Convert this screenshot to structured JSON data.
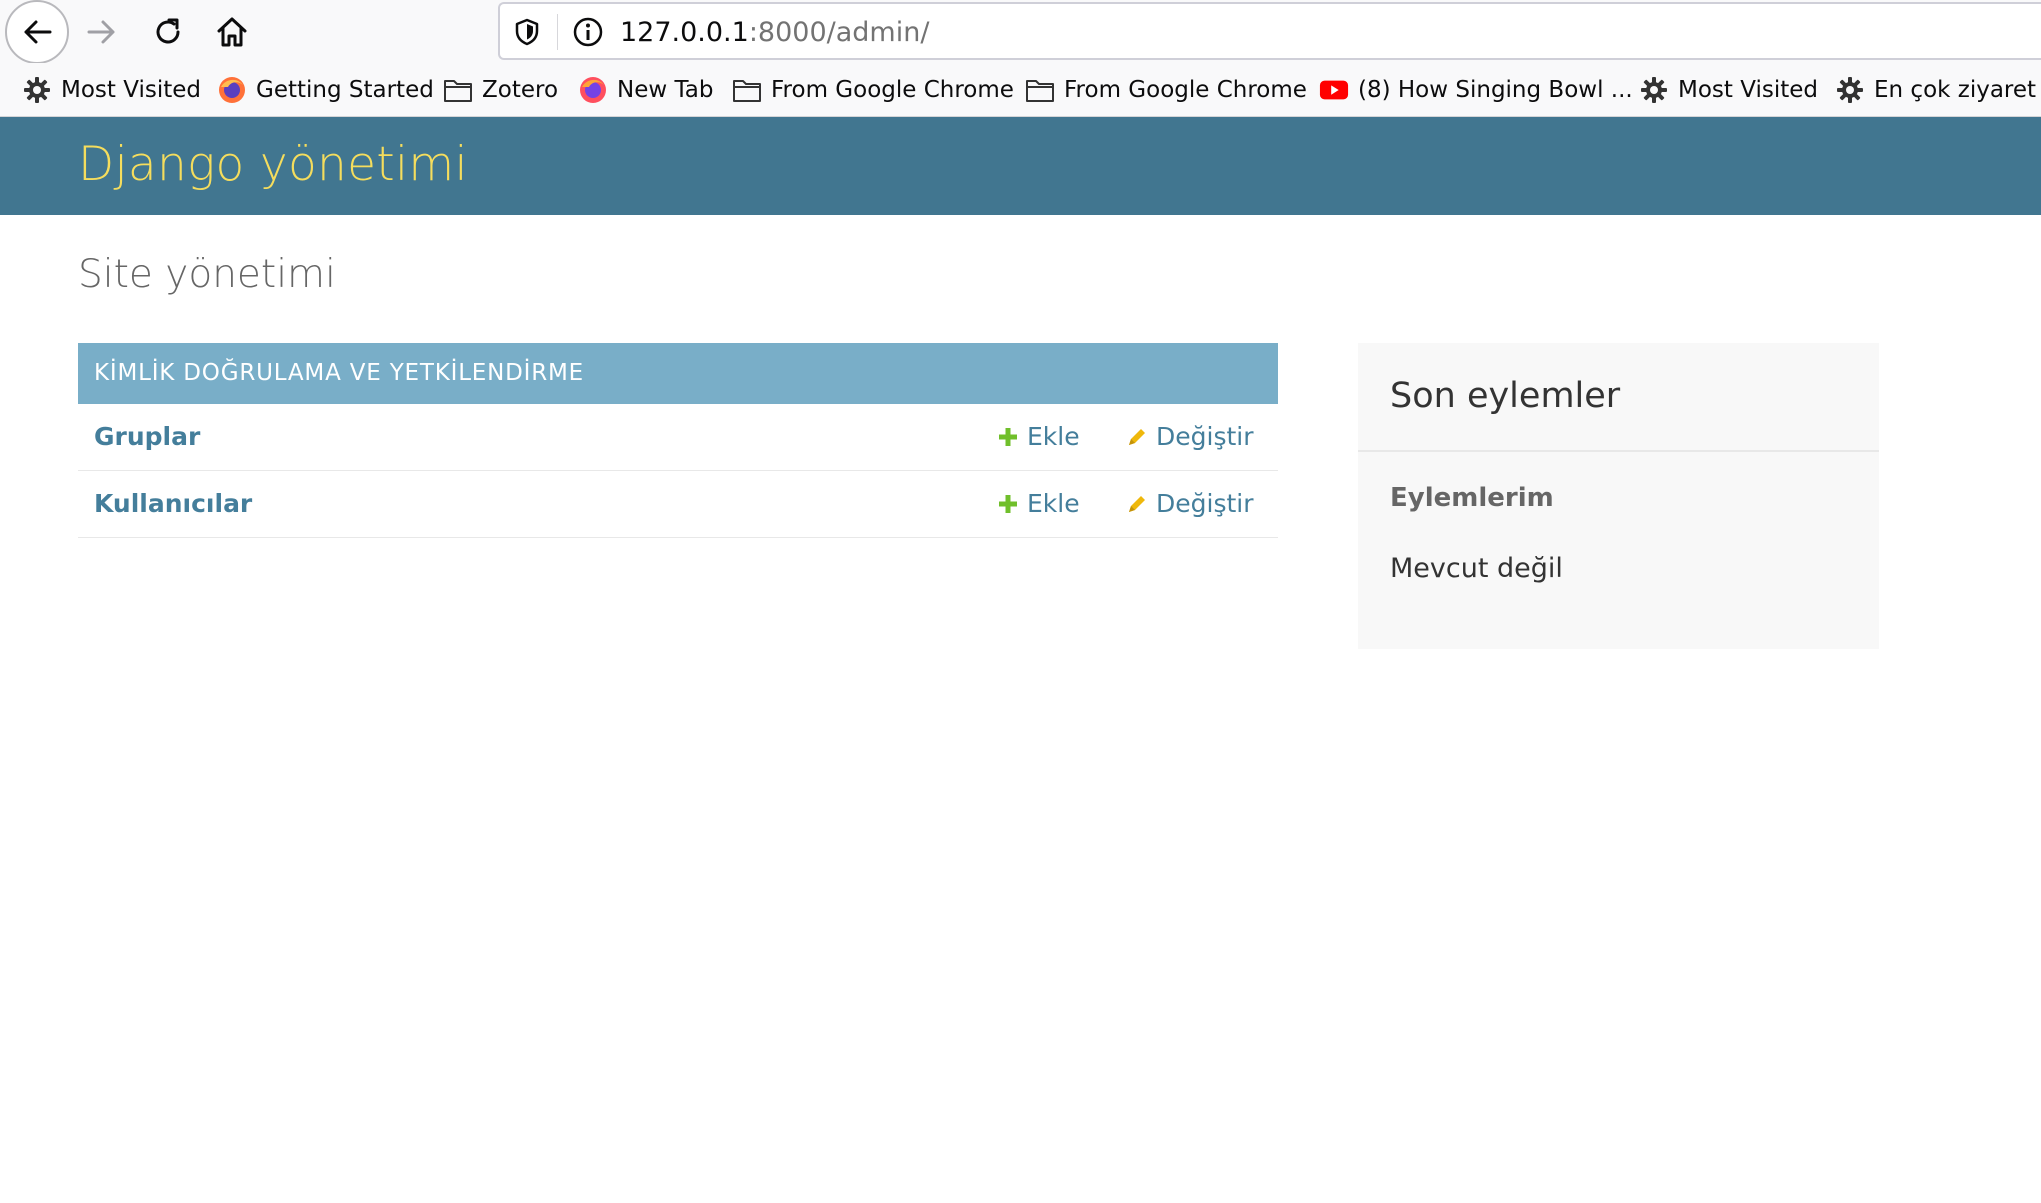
{
  "browser": {
    "url_host": "127.0.0.1",
    "url_rest": ":8000/admin/",
    "bookmarks": [
      {
        "label": "Most Visited",
        "icon": "gear-icon"
      },
      {
        "label": "Getting Started",
        "icon": "firefox-icon"
      },
      {
        "label": "Zotero",
        "icon": "folder-icon"
      },
      {
        "label": "New Tab",
        "icon": "firefox-icon"
      },
      {
        "label": "From Google Chrome",
        "icon": "folder-icon"
      },
      {
        "label": "From Google Chrome",
        "icon": "folder-icon"
      },
      {
        "label": "(8) How Singing Bowl ...",
        "icon": "youtube-icon"
      },
      {
        "label": "Most Visited",
        "icon": "gear-icon"
      },
      {
        "label": "En çok ziyaret e",
        "icon": "gear-icon"
      }
    ]
  },
  "header": {
    "branding": "Django yönetimi"
  },
  "content": {
    "title": "Site yönetimi",
    "module": {
      "caption": "KİMLİK DOĞRULAMA VE YETKİLENDİRME",
      "rows": [
        {
          "name": "Gruplar",
          "add": "Ekle",
          "change": "Değiştir"
        },
        {
          "name": "Kullanıcılar",
          "add": "Ekle",
          "change": "Değiştir"
        }
      ]
    }
  },
  "sidebar": {
    "title": "Son eylemler",
    "subtitle": "Eylemlerim",
    "empty": "Mevcut değil"
  },
  "colors": {
    "header_bg": "#417690",
    "branding": "#f5dd5d",
    "caption_bg": "#79aec8",
    "link": "#447e9b",
    "add_icon": "#70bf2b",
    "change_icon": "#efb80b"
  }
}
